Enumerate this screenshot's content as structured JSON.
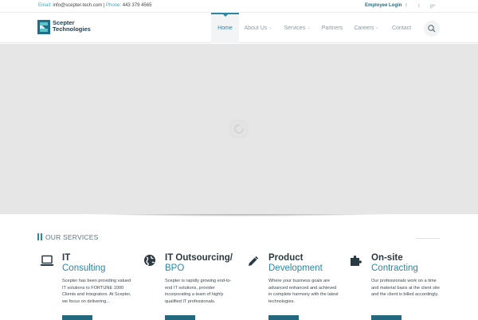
{
  "topbar": {
    "email_label": "Email:",
    "email": "info@scepter-tech.com",
    "separator": "|",
    "phone_label": "Phone:",
    "phone": "443 379 4565",
    "employee_login": "Employee Login",
    "social": [
      "f",
      "t",
      "g+"
    ]
  },
  "brand": {
    "line1": "Scepter",
    "line2": "Technologies"
  },
  "nav": {
    "items": [
      {
        "label": "Home",
        "active": true
      },
      {
        "label": "About Us",
        "dropdown": true
      },
      {
        "label": "Services",
        "dropdown": true
      },
      {
        "label": "Partners"
      },
      {
        "label": "Careers",
        "dropdown": true
      },
      {
        "label": "Contact"
      }
    ]
  },
  "section": {
    "title": "OUR SERVICES"
  },
  "services": [
    {
      "icon": "laptop-icon",
      "title1": "IT",
      "title2": "Consulting",
      "desc": "Scepter has been providing valued IT solutions to FORTUNE 1000 Clients and Integrators. At Scepter, we focus on delivering..."
    },
    {
      "icon": "globe-icon",
      "title1": "IT Outsourcing/",
      "title2": "BPO",
      "desc": "Scepter is rapidly growing end-to-end IT solutions, provider incorporating a team of highly qualified IT professionals."
    },
    {
      "icon": "pencil-icon",
      "title1": "Product",
      "title2": "Development",
      "desc": "Where your business goals are advanced enhanced and achieved in complete harmony with the latest technologies."
    },
    {
      "icon": "puzzle-icon",
      "title1": "On-site",
      "title2": "Contracting",
      "desc": "Our professionals work on a time and material basis at the client site and the client is billed accordingly."
    }
  ],
  "colors": {
    "accent": "#2a87a6",
    "dark": "#2b3940",
    "hero_bg": "#e6e6e6",
    "button": "#24687f"
  }
}
